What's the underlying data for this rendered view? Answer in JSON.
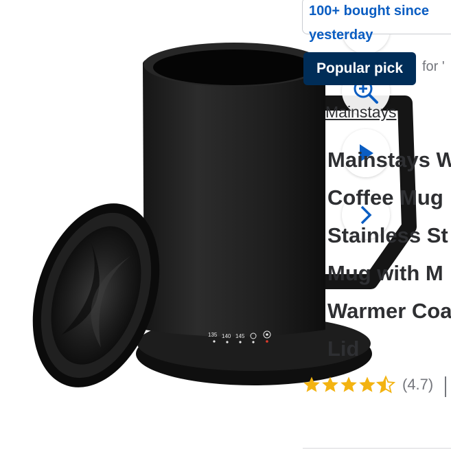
{
  "badges": {
    "bought": [
      "100+ bought since",
      "yesterday"
    ],
    "popular": "Popular pick",
    "for_text": "for '"
  },
  "product": {
    "brand": "Mainstays",
    "title_lines": [
      "Mainstays W",
      "Coffee Mug",
      "Stainless St",
      "Mug with M",
      "Warmer Coa",
      "Lid"
    ],
    "rating": {
      "stars": 4.5,
      "value": "(4.7)"
    },
    "mug_labels": [
      "135",
      "140",
      "145"
    ]
  },
  "icons": [
    "zoom-in-icon",
    "play-icon",
    "chevron-right-icon",
    "chevron-down-icon"
  ],
  "colors": {
    "link_blue": "#0a5dc2",
    "badge_navy": "#002d58",
    "star_gold": "#f3b311",
    "text": "#2e2f32",
    "muted": "#74767c"
  }
}
